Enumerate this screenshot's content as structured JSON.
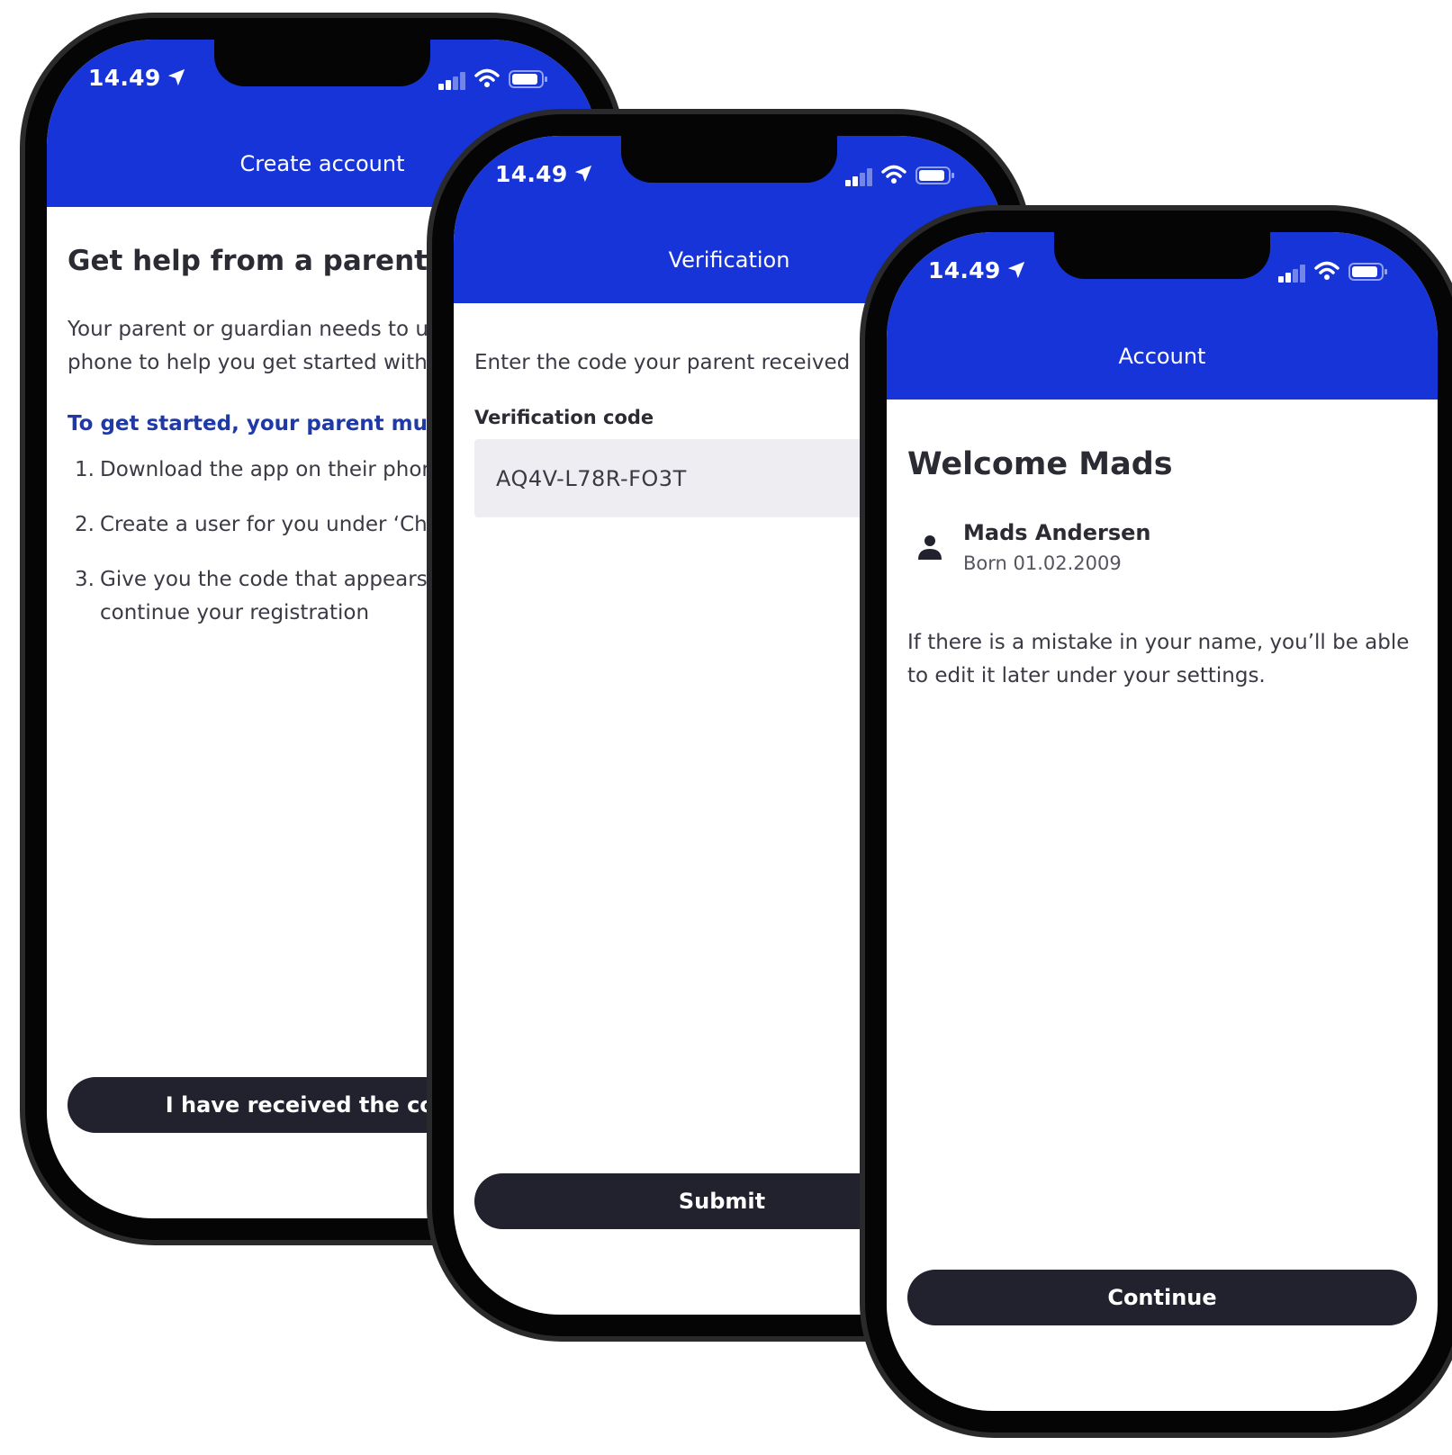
{
  "status_bar": {
    "time": "14.49"
  },
  "screens": [
    {
      "header_title": "Create account",
      "heading": "Get help from a parent",
      "intro": "Your parent or guardian needs to use their phone to help you get started with an app.",
      "subheading": "To get started, your parent must:",
      "steps": [
        {
          "num": "1.",
          "text": "Download the app on their phone"
        },
        {
          "num": "2.",
          "text": "Create a user for you under ‘Children’"
        },
        {
          "num": "3.",
          "text": "Give you the code that appears so you can continue your registration"
        }
      ],
      "button": "I have received the code"
    },
    {
      "header_title": "Verification",
      "instruction": "Enter the code your parent received",
      "field_label": "Verification code",
      "field_value": "AQ4V-L78R-FO3T",
      "button": "Submit"
    },
    {
      "header_title": "Account",
      "heading": "Welcome Mads",
      "person_name": "Mads Andersen",
      "person_born": "Born 01.02.2009",
      "note": "If there is a mistake in your name, you’ll be able to edit it later under your settings.",
      "button": "Continue"
    }
  ],
  "colors": {
    "header_blue": "#1634d8",
    "button_dark": "#22222e",
    "accent_text": "#1f3aa8"
  },
  "icons": [
    "location-arrow-icon",
    "signal-icon",
    "wifi-icon",
    "battery-icon",
    "person-icon"
  ]
}
